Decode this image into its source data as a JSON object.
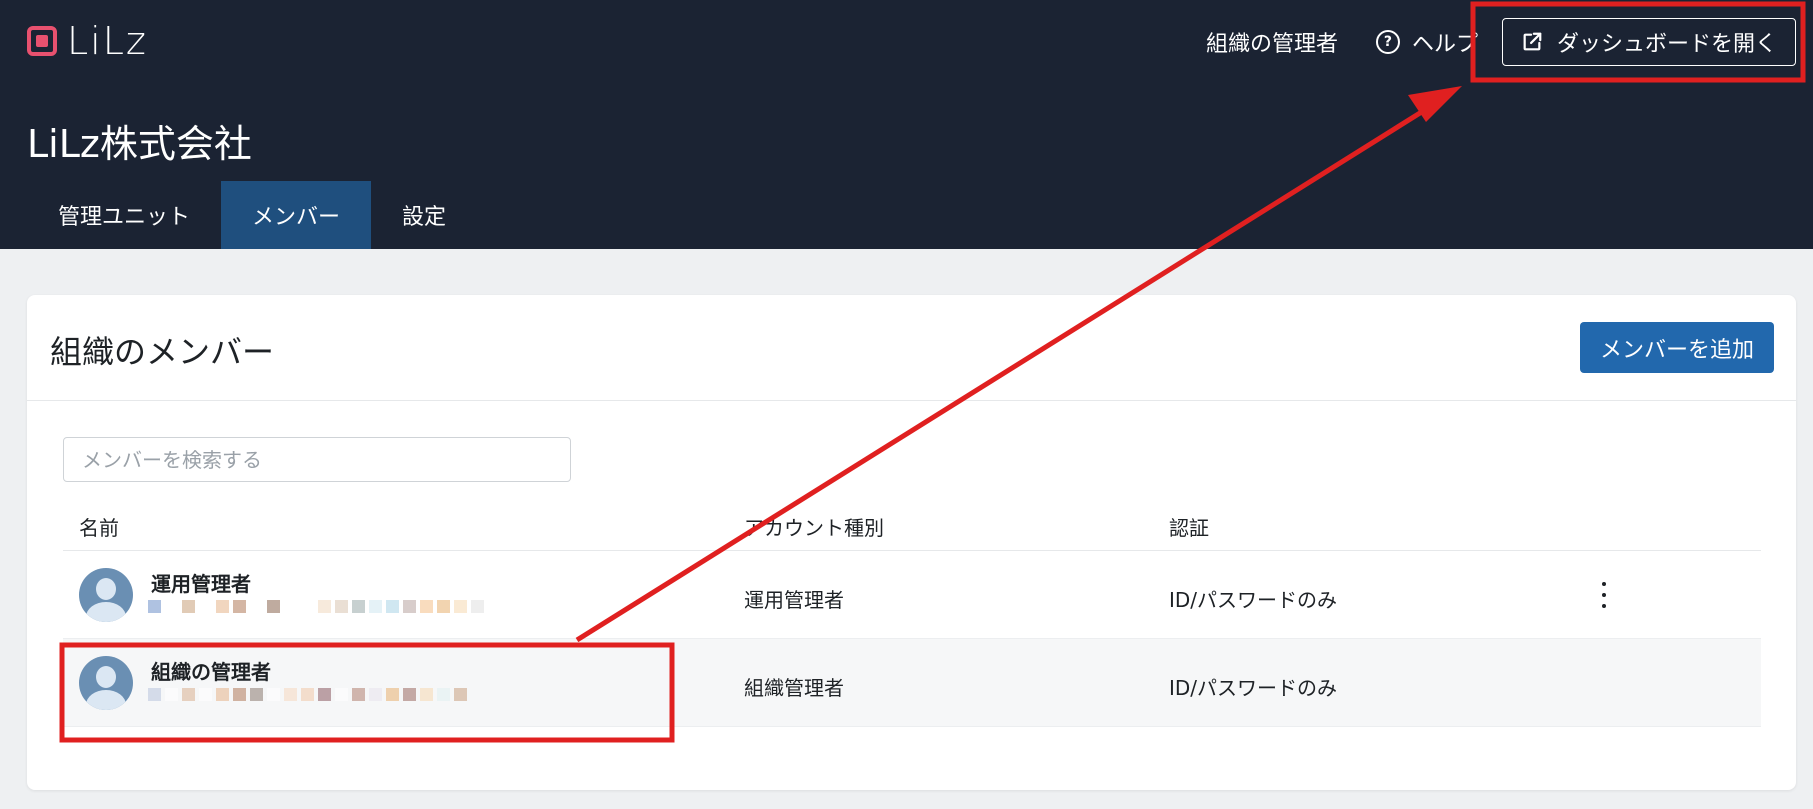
{
  "header": {
    "logo_text": "LiLz",
    "nav_org_admin": "組織の管理者",
    "nav_help": "ヘルプ",
    "dashboard_button": "ダッシュボードを開く",
    "org_name": "LiLz株式会社",
    "tabs": [
      {
        "label": "管理ユニット",
        "active": false
      },
      {
        "label": "メンバー",
        "active": true
      },
      {
        "label": "設定",
        "active": false
      }
    ]
  },
  "main": {
    "title": "組織のメンバー",
    "add_button": "メンバーを追加",
    "search_placeholder": "メンバーを検索する",
    "columns": [
      "名前",
      "アカウント種別",
      "認証"
    ],
    "members": [
      {
        "name": "運用管理者",
        "account_type": "運用管理者",
        "auth": "ID/パスワードのみ",
        "email_redacted": true
      },
      {
        "name": "組織の管理者",
        "account_type": "組織管理者",
        "auth": "ID/パスワードのみ",
        "email_redacted": true
      }
    ]
  },
  "colors": {
    "header_bg": "#1b2333",
    "active_tab": "#1f4f7e",
    "primary_button": "#2268ad",
    "logo_accent": "#e8516f",
    "annotation_red": "#e02020"
  }
}
